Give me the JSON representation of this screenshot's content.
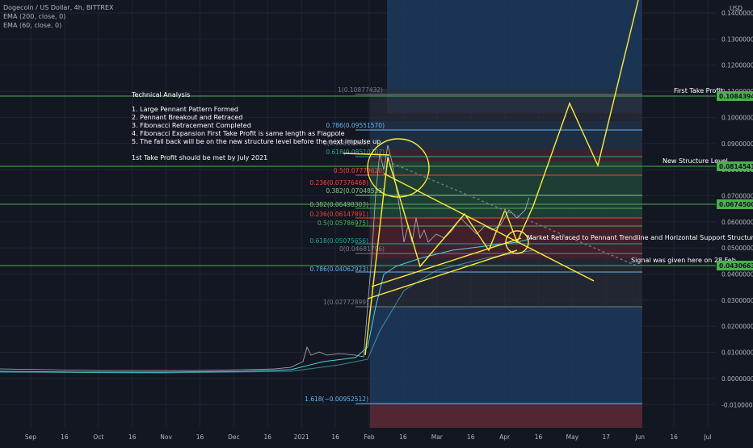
{
  "legend": {
    "symbol": "Dogecoin / US Dollar, 4h, BITTREX",
    "ema200": "EMA (200, close, 0)",
    "ema60": "EMA (60, close, 0)"
  },
  "currency": "USD",
  "colors": {
    "background": "#131722",
    "grid": "#1f2433",
    "horizontal_line": "#4caf50",
    "drawing": "#ffeb3b",
    "price_tag": "#4caf50",
    "candles": "#b2b5be",
    "ema": "#4dd0e1",
    "upper_zone": "#2e7d8a",
    "lower_zone": "#2a3f6b",
    "stop_zone": "#5a2530"
  },
  "price_axis": [
    "0.14000000",
    "0.13000000",
    "0.12000000",
    "0.11000000",
    "0.10000000",
    "0.09000000",
    "0.08000000",
    "0.07000000",
    "0.06000000",
    "0.05000000",
    "0.04000000",
    "0.03000000",
    "0.02000000",
    "0.01000000",
    "0.00000000",
    "-0.01000000"
  ],
  "time_axis": [
    "Sep",
    "16",
    "Oct",
    "16",
    "Nov",
    "16",
    "Dec",
    "16",
    "2021",
    "16",
    "Feb",
    "16",
    "Mar",
    "16",
    "Apr",
    "16",
    "May",
    "17",
    "Jun",
    "16",
    "Jul"
  ],
  "annotation": {
    "title": "Technical Analysis",
    "lines": [
      "1. Large Pennant Pattern Formed",
      "2. Pennant Breakout and Retraced",
      "3. Fibonacci Retracement Completed",
      "4. Fibonacci Expansion First Take Profit is same length as Flagpole",
      "5. The fall back will be on the new structure level before the next impulse up",
      "",
      "1st Take Profit should be met by July 2021"
    ]
  },
  "levels": [
    {
      "name": "First Take Profit",
      "price": "0.10843942"
    },
    {
      "name": "New Structure Level",
      "price": "0.08145417"
    },
    {
      "name": "",
      "price": "0.06745000"
    },
    {
      "name": "Signal was given here on 28 Feb",
      "price": "0.04306638"
    }
  ],
  "side_notes": {
    "retrace": "Market Retraced to Pennant Trendline and Horizontal Support Structure"
  },
  "fib_expansion": [
    {
      "label": "1(0.10877432)"
    },
    {
      "label": "0.786(0.09551570)"
    },
    {
      "label": "0.618(0.08510707)"
    },
    {
      "label": "0.5(0.07779620)"
    },
    {
      "label": "0.382(0.07048533)"
    },
    {
      "label": "0(0.04681796)"
    },
    {
      "label": "1(0.02772899)"
    },
    {
      "label": "1.618(−0.00952512)"
    }
  ],
  "fib_retracement": [
    {
      "label": "0(0.08810063)"
    },
    {
      "label": "0.236(0.07376468)"
    },
    {
      "label": "0.382(0.06498303)"
    },
    {
      "label": "0.236(0.06147891)"
    },
    {
      "label": "0.5(0.05786975)"
    },
    {
      "label": "0.618(0.05075656)"
    },
    {
      "label": "0.786(0.04062923)"
    }
  ]
}
